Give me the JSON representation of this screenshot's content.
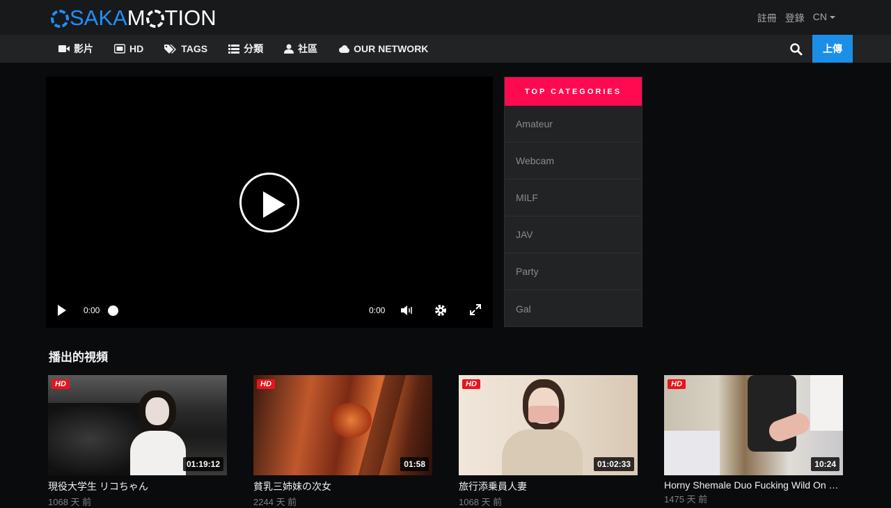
{
  "brand": {
    "logo_part1": "SAKA",
    "logo_part2": "M",
    "logo_part3": "TION"
  },
  "toplinks": {
    "register": "註冊",
    "login": "登錄",
    "lang": "CN"
  },
  "nav": [
    {
      "label": "影片",
      "icon": "video-camera-icon"
    },
    {
      "label": "HD",
      "icon": "hd-icon"
    },
    {
      "label": "TAGS",
      "icon": "tags-icon"
    },
    {
      "label": "分類",
      "icon": "list-icon"
    },
    {
      "label": "社區",
      "icon": "user-icon"
    },
    {
      "label": "OUR NETWORK",
      "icon": "cloud-icon"
    }
  ],
  "upload_label": "上傳",
  "player": {
    "current_time": "0:00",
    "duration": "0:00"
  },
  "sidebar": {
    "heading": "TOP CATEGORIES",
    "categories": [
      "Amateur",
      "Webcam",
      "MILF",
      "JAV",
      "Party",
      "Gal"
    ]
  },
  "section_title": "播出的視頻",
  "videos": [
    {
      "badge": "HD",
      "duration": "01:19:12",
      "title": "現役大学生 リコちゃん",
      "meta": "1068 天 前"
    },
    {
      "badge": "HD",
      "duration": "01:58",
      "title": "貧乳三姉妹の次女",
      "meta": "2244 天 前"
    },
    {
      "badge": "HD",
      "duration": "01:02:33",
      "title": "旅行添乗員人妻",
      "meta": "1068 天 前"
    },
    {
      "badge": "HD",
      "duration": "10:24",
      "title": "Horny Shemale Duo Fucking Wild On Bed",
      "meta": "1475 天 前"
    }
  ],
  "colors": {
    "accent_blue": "#1b8fe8",
    "accent_pink": "#ff0a50",
    "hd_red": "#e8141e"
  }
}
